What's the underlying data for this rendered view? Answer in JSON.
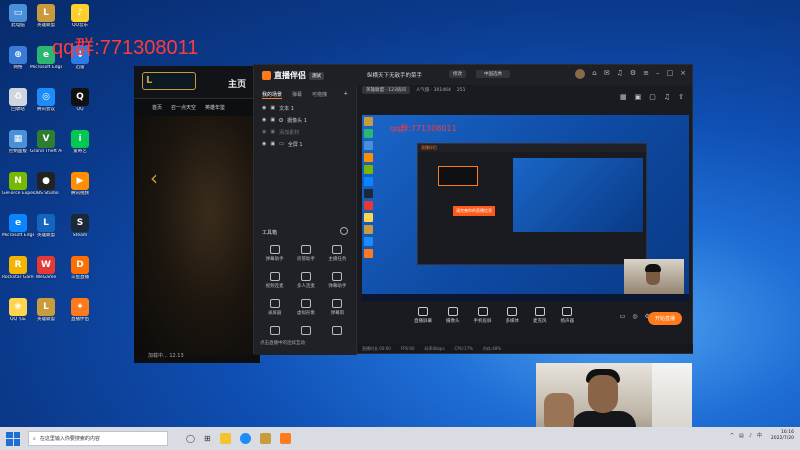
{
  "watermark": "qq群:771308011",
  "desktop_icons": [
    {
      "label": "此电脑",
      "color": "#4a90d9",
      "glyph": "▭"
    },
    {
      "label": "英雄联盟\nWeGame版",
      "color": "#c89b3c",
      "glyph": "L"
    },
    {
      "label": "QQ音乐",
      "color": "#ffcf2e",
      "glyph": "♪"
    },
    {
      "label": "网络",
      "color": "#3a7bd5",
      "glyph": "⊕"
    },
    {
      "label": "Microsoft Edge",
      "color": "#2bb673",
      "glyph": "e"
    },
    {
      "label": "迅雷",
      "color": "#2d7be6",
      "glyph": "↓"
    },
    {
      "label": "回收站",
      "color": "#cfd6e0",
      "glyph": "♻"
    },
    {
      "label": "腾讯会议",
      "color": "#1d8cf8",
      "glyph": "◎"
    },
    {
      "label": "QQ",
      "color": "#111111",
      "glyph": "Q"
    },
    {
      "label": "控制面板",
      "color": "#4a90d9",
      "glyph": "▦"
    },
    {
      "label": "Grand Theft Auto V",
      "color": "#2e7d32",
      "glyph": "V"
    },
    {
      "label": "爱奇艺",
      "color": "#00c853",
      "glyph": "i"
    },
    {
      "label": "GeForce Experience",
      "color": "#76b900",
      "glyph": "N"
    },
    {
      "label": "OBS Studio",
      "color": "#222222",
      "glyph": "●"
    },
    {
      "label": "腾讯视频",
      "color": "#ff8f00",
      "glyph": "▶"
    },
    {
      "label": "Microsoft Edge",
      "color": "#0a84ff",
      "glyph": "e"
    },
    {
      "label": "英雄联盟\nTCL",
      "color": "#1565c0",
      "glyph": "L"
    },
    {
      "label": "Steam",
      "color": "#1b2838",
      "glyph": "S"
    },
    {
      "label": "Rockstar Games",
      "color": "#f4b400",
      "glyph": "R"
    },
    {
      "label": "WeGame",
      "color": "#e53935",
      "glyph": "W"
    },
    {
      "label": "斗鱼直播",
      "color": "#ff6f00",
      "glyph": "D"
    },
    {
      "label": "QQ飞车",
      "color": "#ffd54f",
      "glyph": "❀"
    },
    {
      "label": "英雄联盟",
      "color": "#c89b3c",
      "glyph": "L"
    },
    {
      "label": "直播伴侣",
      "color": "#ff7a1a",
      "glyph": "✦"
    }
  ],
  "lol": {
    "home": "主页",
    "nav": [
      "首页",
      "召一点天空",
      "英雄年鉴"
    ],
    "version": "加载中... 12.13"
  },
  "app": {
    "brand": "直播伴侣",
    "brand_tag": "测试",
    "room_title": "纵横天下无敌手的菜手",
    "edit": "修改",
    "category": "中国选秀",
    "room_info": [
      "英雄联盟 · 123房间",
      "人气值 · 301464",
      "251"
    ],
    "tabs": [
      "我的场景",
      "弹幕",
      "可拖拽"
    ],
    "scenes": [
      "文本 1",
      "摄像头 1",
      "添加素材",
      "全屏 1"
    ],
    "tools_header": "工具箱",
    "tools": [
      "弹幕助手",
      "房管助手",
      "主播任务",
      "视频连麦",
      "多人连麦",
      "弹幕助手",
      "录屏器",
      "虚拟形象",
      "弹幕雨",
      "",
      "",
      ""
    ],
    "left_footer": "点击直播中的连续互动",
    "controls": [
      "直播屏幕",
      "摄像头",
      "手机投屏",
      "多媒体",
      "麦克风",
      "扬声器"
    ],
    "go_live": "开始直播",
    "status": [
      "直播时长 00:00",
      "FPS:60",
      "码率0kbps",
      "CPU:17%",
      "内存:48%"
    ],
    "preview_qq": "qq群:771308011",
    "preview_popup": "请完善你的直播信息"
  },
  "taskbar": {
    "search_placeholder": "在这里输入你要搜索的内容",
    "time": "16:16",
    "date": "2022/7/20",
    "lang": "中"
  }
}
